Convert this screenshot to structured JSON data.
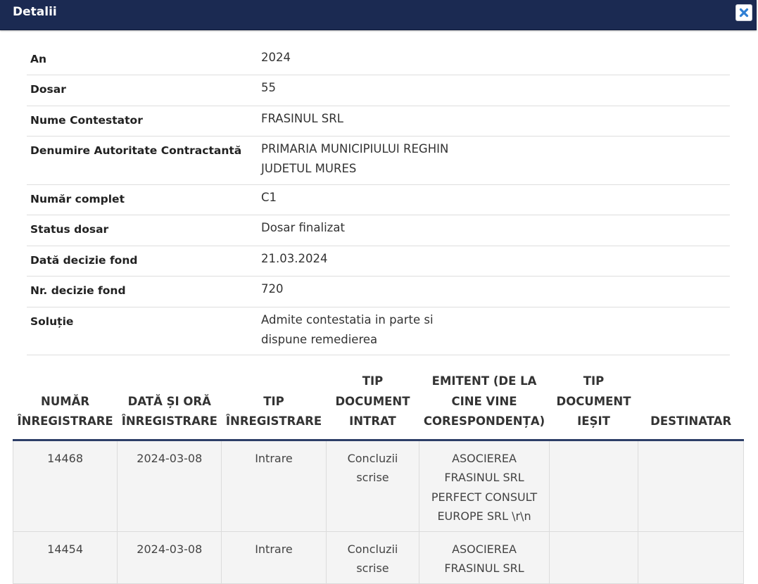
{
  "dialog": {
    "title": "Detalii"
  },
  "details": [
    {
      "label": "An",
      "value": "2024"
    },
    {
      "label": "Dosar",
      "value": "55"
    },
    {
      "label": "Nume Contestator",
      "value": "FRASINUL SRL"
    },
    {
      "label": "Denumire Autoritate Contractantă",
      "value": "PRIMARIA MUNICIPIULUI REGHIN JUDETUL MURES"
    },
    {
      "label": "Număr complet",
      "value": "C1"
    },
    {
      "label": "Status dosar",
      "value": "Dosar finalizat"
    },
    {
      "label": "Dată decizie fond",
      "value": "21.03.2024"
    },
    {
      "label": "Nr. decizie fond",
      "value": "720"
    },
    {
      "label": "Soluție",
      "value": "Admite contestatia in parte si dispune remedierea"
    }
  ],
  "table": {
    "headers": [
      "NUMĂR ÎNREGISTRARE",
      "DATĂ ȘI ORĂ ÎNREGISTRARE",
      "TIP ÎNREGISTRARE",
      "TIP DOCUMENT INTRAT",
      "EMITENT (DE LA CINE VINE CORESPONDENȚA)",
      "TIP DOCUMENT IEȘIT",
      "DESTINATAR"
    ],
    "rows": [
      [
        "14468",
        "2024-03-08",
        "Intrare",
        "Concluzii scrise",
        "ASOCIEREA FRASINUL SRL PERFECT CONSULT EUROPE SRL \\r\\n",
        "",
        ""
      ],
      [
        "14454",
        "2024-03-08",
        "Intrare",
        "Concluzii scrise",
        "ASOCIEREA FRASINUL SRL",
        "",
        ""
      ]
    ]
  },
  "icons": {
    "close": "close-icon"
  },
  "colors": {
    "header_bg": "#1b2a52",
    "close_icon": "#2f7fd4",
    "table_header_border": "#2d3e67",
    "row_bg": "#f4f4f4"
  }
}
